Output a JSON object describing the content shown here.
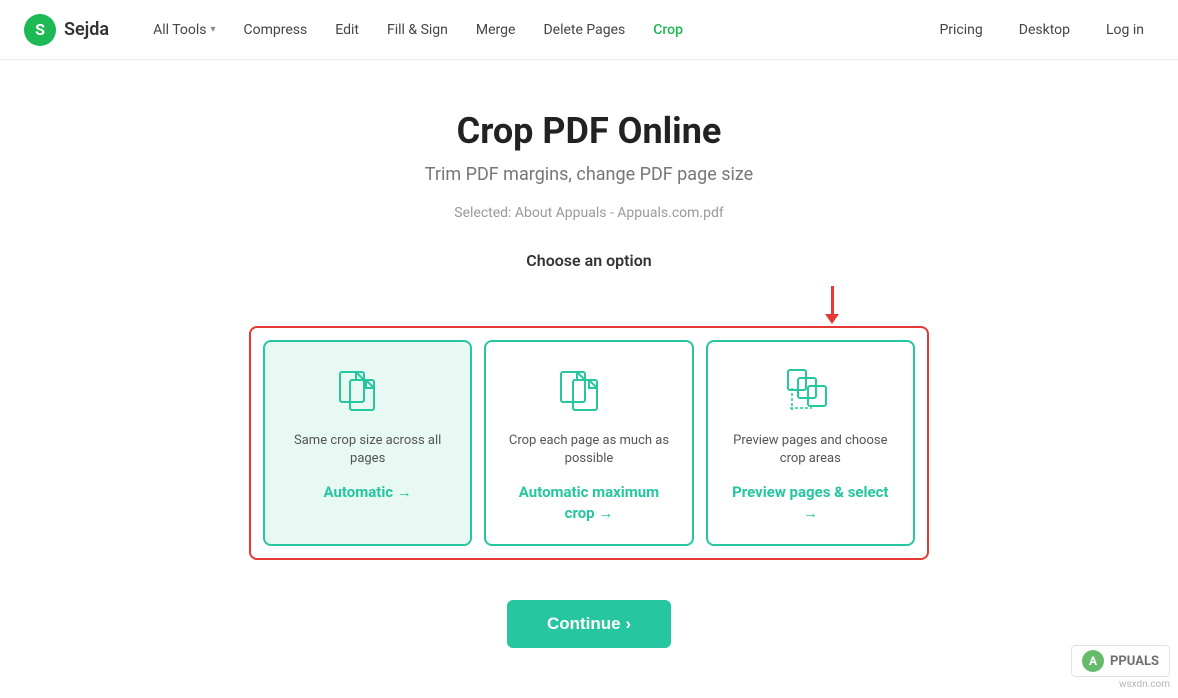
{
  "navbar": {
    "logo_letter": "S",
    "logo_text": "Sejda",
    "nav_items": [
      {
        "label": "All Tools",
        "has_chevron": true
      },
      {
        "label": "Compress",
        "has_chevron": false
      },
      {
        "label": "Edit",
        "has_chevron": false
      },
      {
        "label": "Fill & Sign",
        "has_chevron": false
      },
      {
        "label": "Merge",
        "has_chevron": false
      },
      {
        "label": "Delete Pages",
        "has_chevron": false
      },
      {
        "label": "Crop",
        "has_chevron": false,
        "active": true
      }
    ],
    "right_items": [
      {
        "label": "Pricing"
      },
      {
        "label": "Desktop"
      },
      {
        "label": "Log in"
      }
    ]
  },
  "page": {
    "title": "Crop PDF Online",
    "subtitle": "Trim PDF margins, change PDF page size",
    "selected_file": "Selected: About Appuals - Appuals.com.pdf",
    "choose_label": "Choose an option"
  },
  "options": [
    {
      "id": "automatic",
      "desc": "Same crop size across all pages",
      "action": "Automatic →",
      "selected": true
    },
    {
      "id": "automatic-max",
      "desc": "Crop each page as much as possible",
      "action": "Automatic maximum crop →"
    },
    {
      "id": "preview",
      "desc": "Preview pages and choose crop areas",
      "action": "Preview pages & select →"
    }
  ],
  "continue_button": "Continue ›",
  "watermark": {
    "text": "APPUALS",
    "sub": "wsxdn.com"
  }
}
